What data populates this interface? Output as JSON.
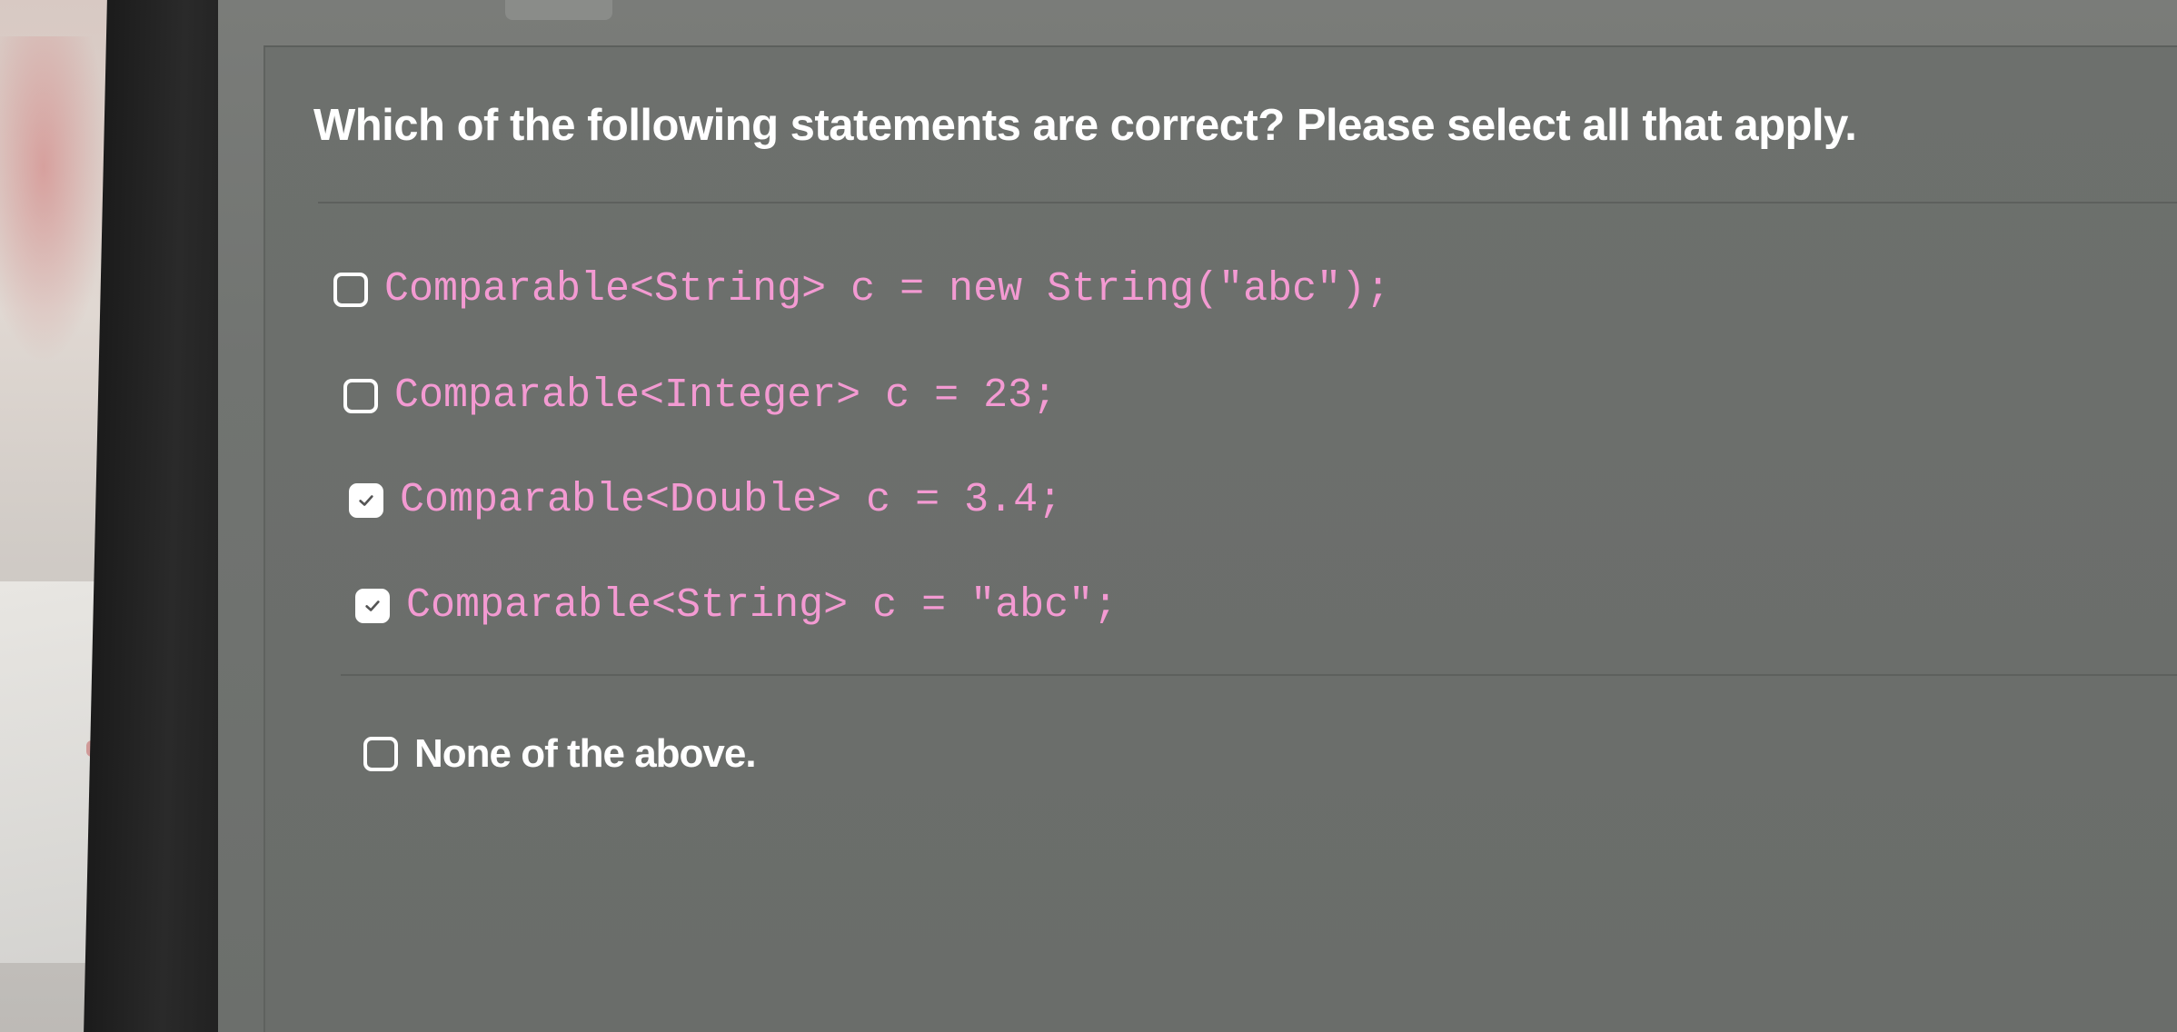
{
  "quiz": {
    "question": "Which of the following statements are correct? Please select all that apply.",
    "options": [
      {
        "label": "Comparable<String> c = new String(\"abc\");",
        "checked": false,
        "style": "code"
      },
      {
        "label": "Comparable<Integer> c = 23;",
        "checked": false,
        "style": "code"
      },
      {
        "label": "Comparable<Double> c = 3.4;",
        "checked": true,
        "style": "code"
      },
      {
        "label": "Comparable<String> c = \"abc\";",
        "checked": true,
        "style": "code"
      },
      {
        "label": "None of the above.",
        "checked": false,
        "style": "plain"
      }
    ]
  },
  "colors": {
    "code_text": "#f39ad2",
    "question_text": "#ffffff",
    "screen_background": "#6d706d"
  },
  "icons": {
    "checkbox_checked": "check-icon"
  }
}
